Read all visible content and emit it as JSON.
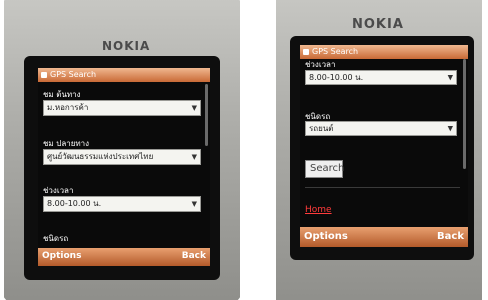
{
  "left_phone": {
    "brand": "NOKIA",
    "app_title": "GPS Search",
    "route_from_label": "ชม ต้นทาง",
    "route_from_value": "ม.หอการค้า",
    "route_to_label": "ชม ปลายทาง",
    "route_to_value": "ศูนย์วัฒนธรรมแห่งประเทศไทย",
    "time_label": "ช่วงเวลา",
    "time_value": "8.00-10.00 น.",
    "vehicle_label": "ชนิดรถ",
    "softkey_left": "Options",
    "softkey_right": "Back"
  },
  "right_phone": {
    "brand": "NOKIA",
    "app_title": "GPS Search",
    "time_label": "ช่วงเวลา",
    "time_value": "8.00-10.00 น.",
    "vehicle_label": "ชนิดรถ",
    "vehicle_value": "รถยนต์",
    "search_button": "Search",
    "home_link": "Home",
    "softkey_left": "Options",
    "softkey_right": "Back"
  },
  "icons": {
    "dropdown": "chevron-down-icon",
    "app": "gps-app-icon"
  },
  "colors": {
    "titlebar": "#c96a36",
    "softbar": "#b35a2a",
    "link": "#ff3b3b"
  }
}
